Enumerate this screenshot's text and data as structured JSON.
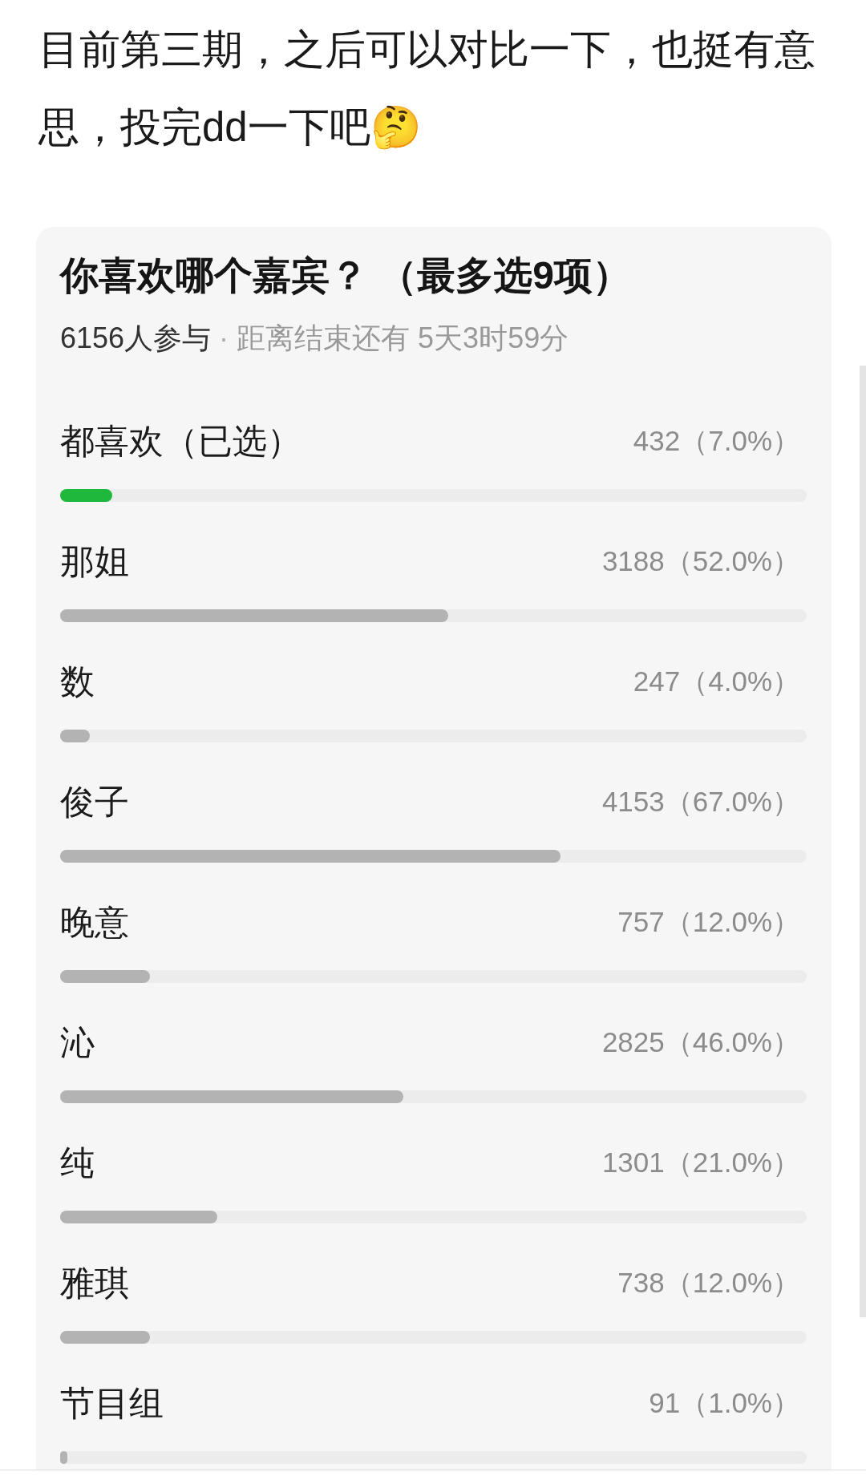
{
  "post": {
    "text": "目前第三期，之后可以对比一下，也挺有意思，投完dd一下吧🤔"
  },
  "poll": {
    "title": "你喜欢哪个嘉宾？ （最多选9项）",
    "participants": "6156人参与",
    "separator": "·",
    "remaining": "距离结束还有 5天3时59分",
    "options": [
      {
        "label": "都喜欢（已选）",
        "count": "432（7.0%）",
        "level": 0.07,
        "selected": true
      },
      {
        "label": "那姐",
        "count": "3188（52.0%）",
        "level": 0.52,
        "selected": false
      },
      {
        "label": "数",
        "count": "247（4.0%）",
        "level": 0.04,
        "selected": false
      },
      {
        "label": "俊子",
        "count": "4153（67.0%）",
        "level": 0.67,
        "selected": false
      },
      {
        "label": "晚意",
        "count": "757（12.0%）",
        "level": 0.12,
        "selected": false
      },
      {
        "label": "沁",
        "count": "2825（46.0%）",
        "level": 0.46,
        "selected": false
      },
      {
        "label": "纯",
        "count": "1301（21.0%）",
        "level": 0.21,
        "selected": false
      },
      {
        "label": "雅琪",
        "count": "738（12.0%）",
        "level": 0.12,
        "selected": false
      },
      {
        "label": "节目组",
        "count": "91（1.0%）",
        "level": 0.01,
        "selected": false
      }
    ]
  }
}
